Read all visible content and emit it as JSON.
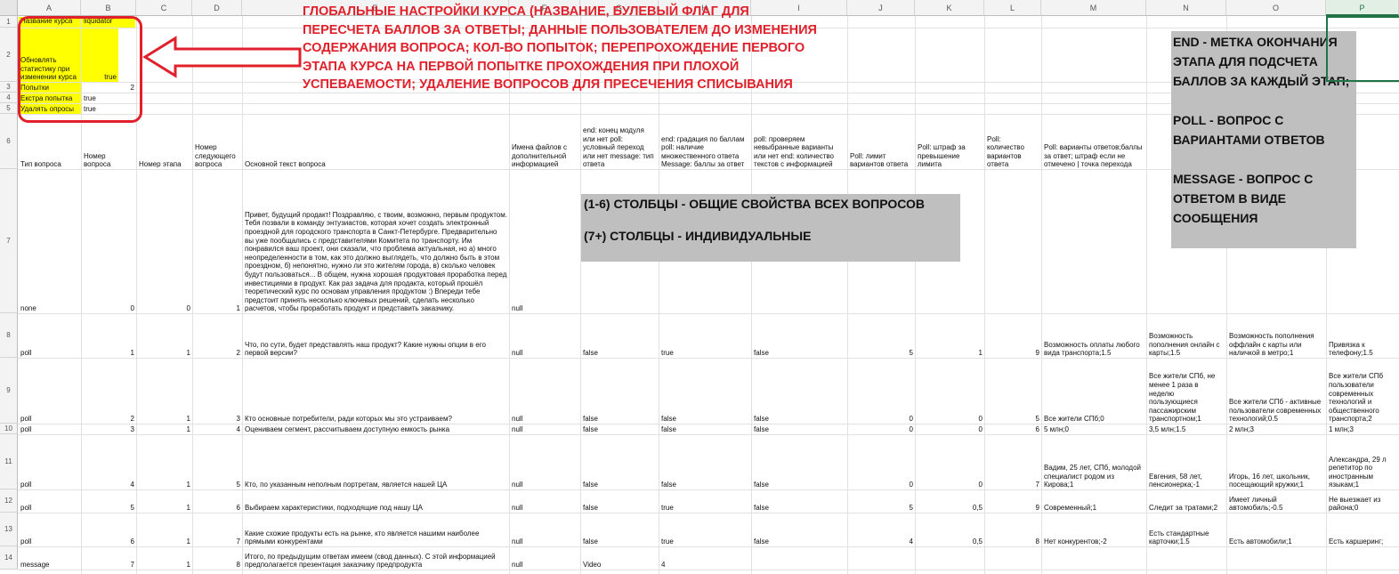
{
  "columns": [
    "A",
    "B",
    "C",
    "D",
    "E",
    "F",
    "G",
    "H",
    "I",
    "J",
    "K",
    "L",
    "M",
    "N",
    "O",
    "P"
  ],
  "rows": [
    "1",
    "2",
    "3",
    "4",
    "5",
    "6",
    "7",
    "8",
    "9",
    "10",
    "11",
    "12",
    "13",
    "14"
  ],
  "settings": {
    "course_name_label": "Название курса",
    "course_name_value": "liquidator",
    "update_stats_label": "Обновлять статистику при изменении курса",
    "update_stats_value": "true",
    "attempts_label": "Попытки",
    "attempts_value": "2",
    "extra_attempt_label": "Екстра попытка",
    "extra_attempt_value": "true",
    "delete_polls_label": "Удалять опросы",
    "delete_polls_value": "true"
  },
  "annotations": {
    "global_settings_note": "ГЛОБАЛЬНЫЕ НАСТРОЙКИ КУРСА (НАЗВАНИЕ, БУЛЕВЫЙ ФЛАГ ДЛЯ ПЕРЕСЧЕТА БАЛЛОВ ЗА ОТВЕТЫ; ДАННЫЕ ПОЛЬЗОВАТЕЛЕМ ДО ИЗМЕНЕНИЯ СОДЕРЖАНИЯ ВОПРОСА; КОЛ-ВО ПОПЫТОК; ПЕРЕПРОХОЖДЕНИЕ ПЕРВОГО ЭТАПА КУРСА НА ПЕРВОЙ ПОПЫТКЕ ПРОХОЖДЕНИЯ ПРИ ПЛОХОЙ УСПЕВАЕМОСТИ; УДАЛЕНИЕ ВОПРОСОВ ДЛЯ ПРЕСЕЧЕНИЯ СПИСЫВАНИЯ",
    "columns_note_1": "(1-6) СТОЛБЦЫ - ОБЩИЕ СВОЙСТВА ВСЕХ ВОПРОСОВ",
    "columns_note_2": "(7+) СТОЛБЦЫ - ИНДИВИДУАЛЬНЫЕ",
    "types_note_1": "END - МЕТКА ОКОНЧАНИЯ ЭТАПА ДЛЯ ПОДСЧЕТА БАЛЛОВ ЗА КАЖДЫЙ ЭТАП;",
    "types_note_2": "POLL - ВОПРОС С ВАРИАНТАМИ ОТВЕТОВ",
    "types_note_3": "MESSAGE - ВОПРОС С ОТВЕТОМ В ВИДЕ СООБЩЕНИЯ",
    "arrow_color": "#e0212b"
  },
  "headers": {
    "A": "Тип вопроса",
    "B": "Номер вопроса",
    "C": "Номер этапа",
    "D": "Номер следующего вопроса",
    "E": "Основной текст вопроса",
    "F": "Имена файлов с дополнительной информацией",
    "G": "end: конец модуля или нет poll: условный переход или нет message: тип ответа",
    "H": "end: градация по баллам poll: наличие множественного ответа Message: баллы за ответ",
    "I": "poll: проверяем невыбранные варианты или нет end: количество текстов с информацией",
    "J": "Poll: лимит вариантов ответа",
    "K": "Poll: штраф за превышение лимита",
    "L": "Poll: количество вариантов ответа",
    "M": "Poll: варианты ответов;баллы за ответ; штраф если не отмечено | точка перехода"
  },
  "table": [
    {
      "A": "none",
      "B": "0",
      "C": "0",
      "D": "1",
      "E": "Привет, будущий продакт! Поздравляю, с твоим, возможно, первым продуктом. Тебя позвали в команду энтузиастов, которая хочет создать электронный проездной для городского транспорта в Санкт-Петербурге. Предварительно вы уже пообщались с представителями Комитета по транспорту. Им понравился ваш проект, они сказали, что проблема актуальная, но а) много неопределенности в том, как это должно выглядеть, что должно быть в этом проездном, б) непонятно, нужно ли это жителям города, в) сколько человек будут пользоваться... В общем, нужна хорошая продуктовая проработка перед инвестициями в продукт. Как раз задача для продакта, который прошёл теоретический курс по основам управления продуктом :) Впереди тебе предстоит принять несколько ключевых решений, сделать несколько расчетов, чтобы проработать продукт и представить заказчику.",
      "F": "null",
      "G": "",
      "H": "",
      "I": "",
      "J": "",
      "K": "",
      "L": "",
      "M": "",
      "N": "",
      "O": "",
      "P": ""
    },
    {
      "A": "poll",
      "B": "1",
      "C": "1",
      "D": "2",
      "E": "Что, по сути, будет представлять наш продукт? Какие нужны опции в его первой версии?",
      "F": "null",
      "G": "false",
      "H": "true",
      "I": "false",
      "J": "5",
      "K": "1",
      "L": "9",
      "M": "Возможность оплаты любого вида транспорта;1.5",
      "N": "Возможность пополнения онлайн с карты;1.5",
      "O": "Возможность пополнения оффлайн с карты или наличкой в метро;1",
      "P": "Привязка к телефону;1.5"
    },
    {
      "A": "poll",
      "B": "2",
      "C": "1",
      "D": "3",
      "E": "Кто основные потребители, ради которых мы это устраиваем?",
      "F": "null",
      "G": "false",
      "H": "false",
      "I": "false",
      "J": "0",
      "K": "0",
      "L": "5",
      "M": "Все жители СПб;0",
      "N": "Все жители СПб, не менее 1 раза в неделю пользующиеся пассажирским транспортном;1",
      "O": "Все жители СПб - активные пользователи современных технологий;0.5",
      "P": "Все жители СПб пользователи современных технологий и общественного транспорта;2"
    },
    {
      "A": "poll",
      "B": "3",
      "C": "1",
      "D": "4",
      "E": "Оцениваем сегмент, рассчитываем доступную емкость рынка",
      "F": "null",
      "G": "false",
      "H": "false",
      "I": "false",
      "J": "0",
      "K": "0",
      "L": "6",
      "M": "5 млн;0",
      "N": "3,5 млн;1.5",
      "O": "2 млн;3",
      "P": "1 млн;3"
    },
    {
      "A": "poll",
      "B": "4",
      "C": "1",
      "D": "5",
      "E": "Кто, по указанным неполным портретам, является нашей ЦА",
      "F": "null",
      "G": "false",
      "H": "false",
      "I": "false",
      "J": "0",
      "K": "0",
      "L": "7",
      "M": "Вадим, 25 лет, СПб, молодой специалист родом из Кирова;1",
      "N": "Евгения, 58 лет, пенсионерка;-1",
      "O": "Игорь, 16 лет, школьник, посещающий кружки;1",
      "P": "Александра, 29 л репетитор по иностранным языкам;1"
    },
    {
      "A": "poll",
      "B": "5",
      "C": "1",
      "D": "6",
      "E": "Выбираем характеристики, подходящие под нашу ЦА",
      "F": "null",
      "G": "false",
      "H": "true",
      "I": "false",
      "J": "5",
      "K": "0,5",
      "L": "9",
      "M": "Современный;1",
      "N": "Следит за тратами;2",
      "O": "Имеет личный автомобиль;-0.5",
      "P": "Не выезжает из района;0"
    },
    {
      "A": "poll",
      "B": "6",
      "C": "1",
      "D": "7",
      "E": "Какие схожие продукты есть на рынке, кто является нашими наиболее прямыми конкурентами",
      "F": "null",
      "G": "false",
      "H": "true",
      "I": "false",
      "J": "4",
      "K": "0,5",
      "L": "8",
      "M": "Нет конкурентов;-2",
      "N": "Есть стандартные карточки;1.5",
      "O": "Есть автомобили;1",
      "P": "Есть каршеринг;"
    },
    {
      "A": "message",
      "B": "7",
      "C": "1",
      "D": "8",
      "E": "Итого, по предыдущим ответам имеем (свод данных). С этой информацией предполагается презентация заказчику предпродукта",
      "F": "null",
      "G": "Video",
      "H": "4",
      "I": "",
      "J": "",
      "K": "",
      "L": "",
      "M": "",
      "N": "",
      "O": "",
      "P": ""
    }
  ]
}
